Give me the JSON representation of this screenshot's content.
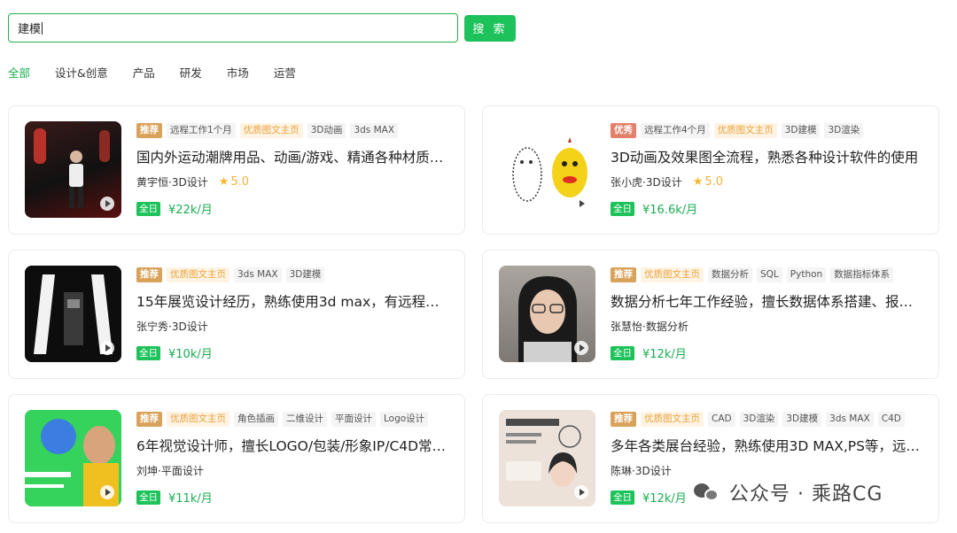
{
  "search": {
    "value": "建模",
    "button_label": "搜 索"
  },
  "tabs": [
    {
      "label": "全部",
      "active": true
    },
    {
      "label": "设计&创意",
      "active": false
    },
    {
      "label": "产品",
      "active": false
    },
    {
      "label": "研发",
      "active": false
    },
    {
      "label": "市场",
      "active": false
    },
    {
      "label": "运营",
      "active": false
    }
  ],
  "cards": [
    {
      "badge": "推荐",
      "badge_type": "rec",
      "tags": [
        "远程工作1个月",
        "优质图文主页",
        "3D动画",
        "3ds MAX"
      ],
      "quality_tag": "优质图文主页",
      "title": "国内外运动潮牌用品、动画/游戏、精通各种材质…",
      "person": "黄宇恒·3D设计",
      "rating": "5.0",
      "work_type": "全日",
      "salary": "¥22k/月",
      "thumb_color": "#2a1414"
    },
    {
      "badge": "优秀",
      "badge_type": "excellent",
      "tags": [
        "远程工作4个月",
        "优质图文主页",
        "3D建模",
        "3D渲染"
      ],
      "quality_tag": "优质图文主页",
      "title": "3D动画及效果图全流程，熟悉各种设计软件的使用",
      "person": "张小虎·3D设计",
      "rating": "5.0",
      "work_type": "全日",
      "salary": "¥16.6k/月",
      "thumb_color": "#ffffff"
    },
    {
      "badge": "推荐",
      "badge_type": "rec",
      "tags": [
        "优质图文主页",
        "3ds MAX",
        "3D建模"
      ],
      "quality_tag": "优质图文主页",
      "title": "15年展览设计经历，熟练使用3d max，有远程办…",
      "person": "张宁秀·3D设计",
      "rating": "",
      "work_type": "全日",
      "salary": "¥10k/月",
      "thumb_color": "#111111"
    },
    {
      "badge": "推荐",
      "badge_type": "rec",
      "tags": [
        "优质图文主页",
        "数据分析",
        "SQL",
        "Python",
        "数据指标体系"
      ],
      "quality_tag": "优质图文主页",
      "title": "数据分析七年工作经验，擅长数据体系搭建、报…",
      "person": "张慧怡·数据分析",
      "rating": "",
      "work_type": "全日",
      "salary": "¥12k/月",
      "thumb_color": "#8f8a86"
    },
    {
      "badge": "推荐",
      "badge_type": "rec",
      "tags": [
        "优质图文主页",
        "角色插画",
        "二维设计",
        "平面设计",
        "Logo设计"
      ],
      "quality_tag": "优质图文主页",
      "title": "6年视觉设计师，擅长LOGO/包装/形象IP/C4D常…",
      "person": "刘坤·平面设计",
      "rating": "",
      "work_type": "全日",
      "salary": "¥11k/月",
      "thumb_color": "#2ecc55"
    },
    {
      "badge": "推荐",
      "badge_type": "rec",
      "tags": [
        "优质图文主页",
        "CAD",
        "3D渲染",
        "3D建模",
        "3ds MAX",
        "C4D"
      ],
      "quality_tag": "优质图文主页",
      "title": "多年各类展台经验，熟练使用3D MAX,PS等，远…",
      "person": "陈琳·3D设计",
      "rating": "",
      "work_type": "全日",
      "salary": "¥12k/月",
      "thumb_color": "#eadfd8"
    }
  ],
  "watermark": {
    "text": "公众号 · 乘路CG"
  }
}
